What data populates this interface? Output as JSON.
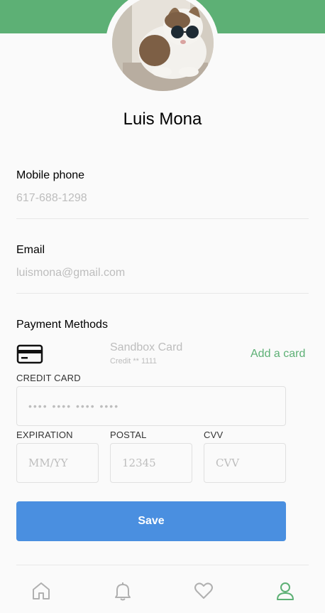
{
  "profile": {
    "name": "Luis Mona"
  },
  "fields": {
    "phone": {
      "label": "Mobile phone",
      "value": "617-688-1298"
    },
    "email": {
      "label": "Email",
      "value": "luismona@gmail.com"
    }
  },
  "payment": {
    "title": "Payment Methods",
    "card_name": "Sandbox Card",
    "card_sub": "Credit ** 1111",
    "add_card_label": "Add a card",
    "credit_card_label": "CREDIT CARD",
    "credit_card_placeholder": "•••• •••• •••• ••••",
    "expiration_label": "EXPIRATION",
    "expiration_placeholder": "MM/YY",
    "postal_label": "POSTAL",
    "postal_placeholder": "12345",
    "cvv_label": "CVV",
    "cvv_placeholder": "CVV",
    "save_label": "Save"
  },
  "tabs": [
    {
      "name": "home-icon",
      "active": false
    },
    {
      "name": "bell-icon",
      "active": false
    },
    {
      "name": "heart-icon",
      "active": false
    },
    {
      "name": "user-icon",
      "active": true
    }
  ],
  "colors": {
    "accent": "#5db075",
    "button": "#4a8fe0",
    "muted": "#bdbdbd"
  }
}
